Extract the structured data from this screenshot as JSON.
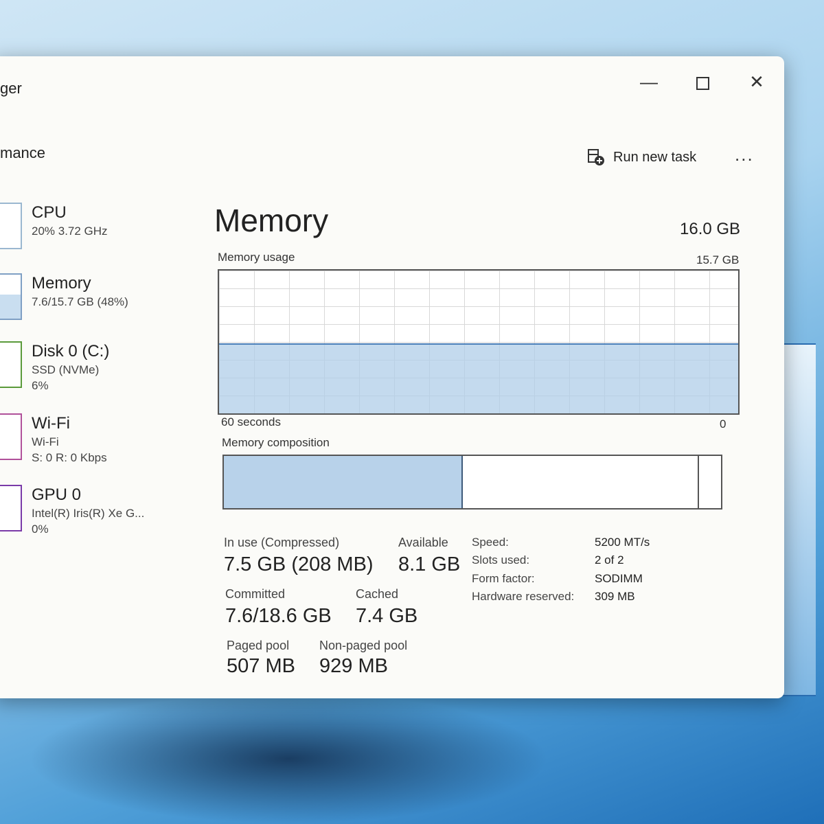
{
  "window": {
    "title_partial": "ger",
    "controls": {
      "minimize": "—",
      "close": "✕"
    }
  },
  "toolbar": {
    "section_partial": "mance",
    "run_new_task": "Run new task",
    "more": "..."
  },
  "sidebar": {
    "items": [
      {
        "name": "CPU",
        "sub1": "20%  3.72 GHz",
        "sub2": ""
      },
      {
        "name": "Memory",
        "sub1": "7.6/15.7 GB (48%)",
        "sub2": ""
      },
      {
        "name": "Disk 0 (C:)",
        "sub1": "SSD (NVMe)",
        "sub2": "6%"
      },
      {
        "name": "Wi-Fi",
        "sub1": "Wi-Fi",
        "sub2": "S: 0  R: 0 Kbps"
      },
      {
        "name": "GPU 0",
        "sub1": "Intel(R) Iris(R) Xe G...",
        "sub2": "0%"
      }
    ]
  },
  "main": {
    "title": "Memory",
    "total": "16.0 GB",
    "usage_label": "Memory usage",
    "usage_max": "15.7 GB",
    "x_left": "60 seconds",
    "x_right": "0",
    "usage_fraction": 0.48,
    "composition_label": "Memory composition",
    "composition": {
      "in_use_fraction": 0.48,
      "available_end_fraction": 0.955
    }
  },
  "stats": {
    "in_use_label": "In use (Compressed)",
    "in_use_value": "7.5 GB (208 MB)",
    "available_label": "Available",
    "available_value": "8.1 GB",
    "committed_label": "Committed",
    "committed_value": "7.6/18.6 GB",
    "cached_label": "Cached",
    "cached_value": "7.4 GB",
    "paged_label": "Paged pool",
    "paged_value": "507 MB",
    "nonpaged_label": "Non-paged pool",
    "nonpaged_value": "929 MB"
  },
  "props": {
    "speed_label": "Speed:",
    "speed_value": "5200 MT/s",
    "slots_label": "Slots used:",
    "slots_value": "2 of 2",
    "form_label": "Form factor:",
    "form_value": "SODIMM",
    "hw_label": "Hardware reserved:",
    "hw_value": "309 MB"
  }
}
